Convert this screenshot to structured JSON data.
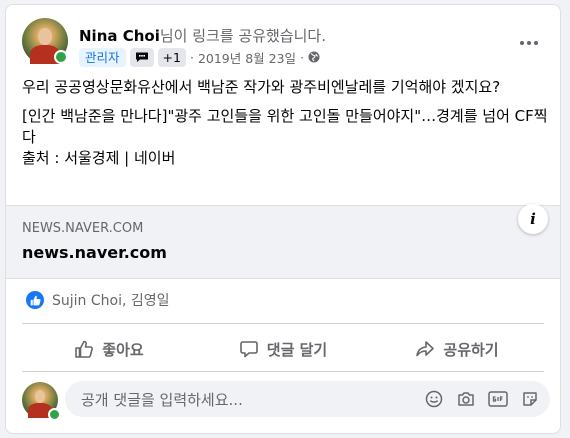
{
  "post": {
    "author": "Nina Choi",
    "action_text": "님이 링크를 공유했습니다.",
    "badge_admin": "관리자",
    "badge_plus": "+1",
    "separator": "·",
    "timestamp": "2019년 8월 23일",
    "privacy_icon": "globe-icon",
    "text_line1": "우리 공공영상문화유산에서 백남준 작가와 광주비엔날레를 기억해야 겠지요?",
    "text_line2": "[인간 백남준을 만나다]\"광주 고인들을 위한 고인돌 만들어야지\"…경계를 넘어 CF찍다",
    "text_line3": "출처 : 서울경제 | 네이버"
  },
  "link_preview": {
    "domain": "NEWS.NAVER.COM",
    "title": "news.naver.com",
    "info_icon": "info-icon"
  },
  "reactions": {
    "icon": "like-icon",
    "names": "Sujin Choi, 김영일"
  },
  "actions": {
    "like": "좋아요",
    "comment": "댓글 달기",
    "share": "공유하기"
  },
  "comment_box": {
    "placeholder": "공개 댓글을 입력하세요...",
    "icons": [
      "emoji-icon",
      "camera-icon",
      "gif-icon",
      "sticker-icon"
    ]
  },
  "colors": {
    "accent": "#1877f2",
    "online": "#31a24c",
    "badge_bg": "#e7f3ff",
    "badge_text": "#1b74e4"
  }
}
